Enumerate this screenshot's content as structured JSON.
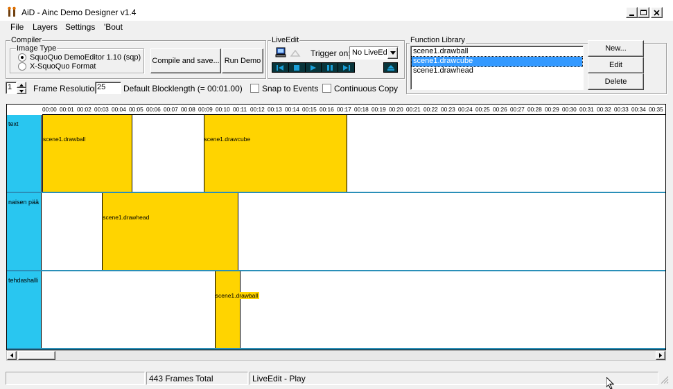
{
  "window": {
    "title": "AiD - Ainc Demo Designer v1.4"
  },
  "menu": [
    "File",
    "Layers",
    "Settings",
    "'Bout"
  ],
  "compiler": {
    "group_label": "Compiler",
    "image_type_label": "Image Type",
    "options": [
      {
        "label": "SquoQuo DemoEditor 1.10 (sqp)",
        "checked": true
      },
      {
        "label": "X-SquoQuo Format",
        "checked": false
      }
    ],
    "compile_label": "Compile and save...",
    "run_label": "Run Demo"
  },
  "liveedit": {
    "group_label": "LiveEdit",
    "trigger_label": "Trigger on:",
    "trigger_value": "No LiveEd"
  },
  "function_library": {
    "group_label": "Function Library",
    "items": [
      "scene1.drawball",
      "scene1.drawcube",
      "scene1.drawhead"
    ],
    "selected_index": 1,
    "new_label": "New...",
    "edit_label": "Edit",
    "delete_label": "Delete"
  },
  "settings_row": {
    "frame_res_value": "1",
    "frame_res_label": "Frame Resolution",
    "blocklength_value": "25",
    "blocklength_label": "Default Blocklength (= 00:01.00)",
    "snap_label": "Snap to Events",
    "continuous_label": "Continuous Copy"
  },
  "ruler_ticks": [
    "00:00",
    "00:01",
    "00:02",
    "00:03",
    "00:04",
    "00:05",
    "00:06",
    "00:07",
    "00:08",
    "00:09",
    "00:10",
    "00:11",
    "00:12",
    "00:13",
    "00:14",
    "00:15",
    "00:16",
    "00:17",
    "00:18",
    "00:19",
    "00:20",
    "00:21",
    "00:22",
    "00:23",
    "00:24",
    "00:25",
    "00:26",
    "00:27",
    "00:28",
    "00:29",
    "00:30",
    "00:31",
    "00:32",
    "00:33",
    "00:34",
    "00:35"
  ],
  "tracks": [
    {
      "name": "text",
      "blocks": [
        {
          "label": "scene1.drawball",
          "start": 0,
          "end": 5.2
        },
        {
          "label": "scene1.drawcube",
          "start": 9.3,
          "end": 17.6
        }
      ]
    },
    {
      "name": "naisen pää",
      "blocks": [
        {
          "label": "scene1.drawhead",
          "start": 3.45,
          "end": 11.3
        }
      ]
    },
    {
      "name": "tehdashalli",
      "blocks": [
        {
          "label": "scene1.drawball",
          "start": 9.95,
          "end": 11.45
        }
      ]
    }
  ],
  "status": {
    "frames_total": "443 Frames Total",
    "liveedit_state": "LiveEdit - Play"
  }
}
